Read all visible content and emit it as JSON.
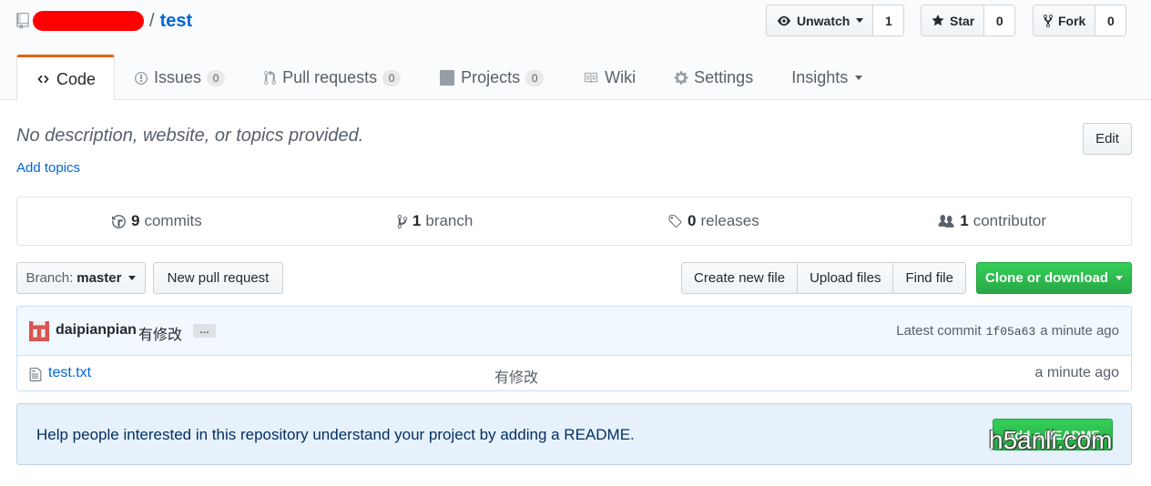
{
  "repo": {
    "separator": "/",
    "name": "test"
  },
  "actions": {
    "watch": {
      "label": "Unwatch",
      "count": "1"
    },
    "star": {
      "label": "Star",
      "count": "0"
    },
    "fork": {
      "label": "Fork",
      "count": "0"
    }
  },
  "tabs": {
    "code": {
      "label": "Code"
    },
    "issues": {
      "label": "Issues",
      "count": "0"
    },
    "pulls": {
      "label": "Pull requests",
      "count": "0"
    },
    "projects": {
      "label": "Projects",
      "count": "0"
    },
    "wiki": {
      "label": "Wiki"
    },
    "settings": {
      "label": "Settings"
    },
    "insights": {
      "label": "Insights"
    }
  },
  "description": {
    "text": "No description, website, or topics provided.",
    "add_topics": "Add topics",
    "edit_label": "Edit"
  },
  "summary": {
    "commits": {
      "num": "9",
      "label": "commits"
    },
    "branches": {
      "num": "1",
      "label": "branch"
    },
    "releases": {
      "num": "0",
      "label": "releases"
    },
    "contributors": {
      "num": "1",
      "label": "contributor"
    }
  },
  "file_nav": {
    "branch_label": "Branch:",
    "branch_value": "master",
    "new_pr": "New pull request",
    "create_file": "Create new file",
    "upload_files": "Upload files",
    "find_file": "Find file",
    "clone": "Clone or download"
  },
  "commit": {
    "author": "daipianpian",
    "message": "有修改",
    "ellipsis": "…",
    "latest_label": "Latest commit",
    "sha": "1f05a63",
    "age": "a minute ago"
  },
  "files": [
    {
      "name": "test.txt",
      "message": "有修改",
      "age": "a minute ago"
    }
  ],
  "readme": {
    "text": "Help people interested in this repository understand your project by adding a README.",
    "button": "Add a README"
  },
  "watermark": "h5anli.com",
  "colors": {
    "accent_tab": "#e36209",
    "link": "#0366d6",
    "primary_button": "#28a745",
    "redaction": "#ff0000"
  }
}
